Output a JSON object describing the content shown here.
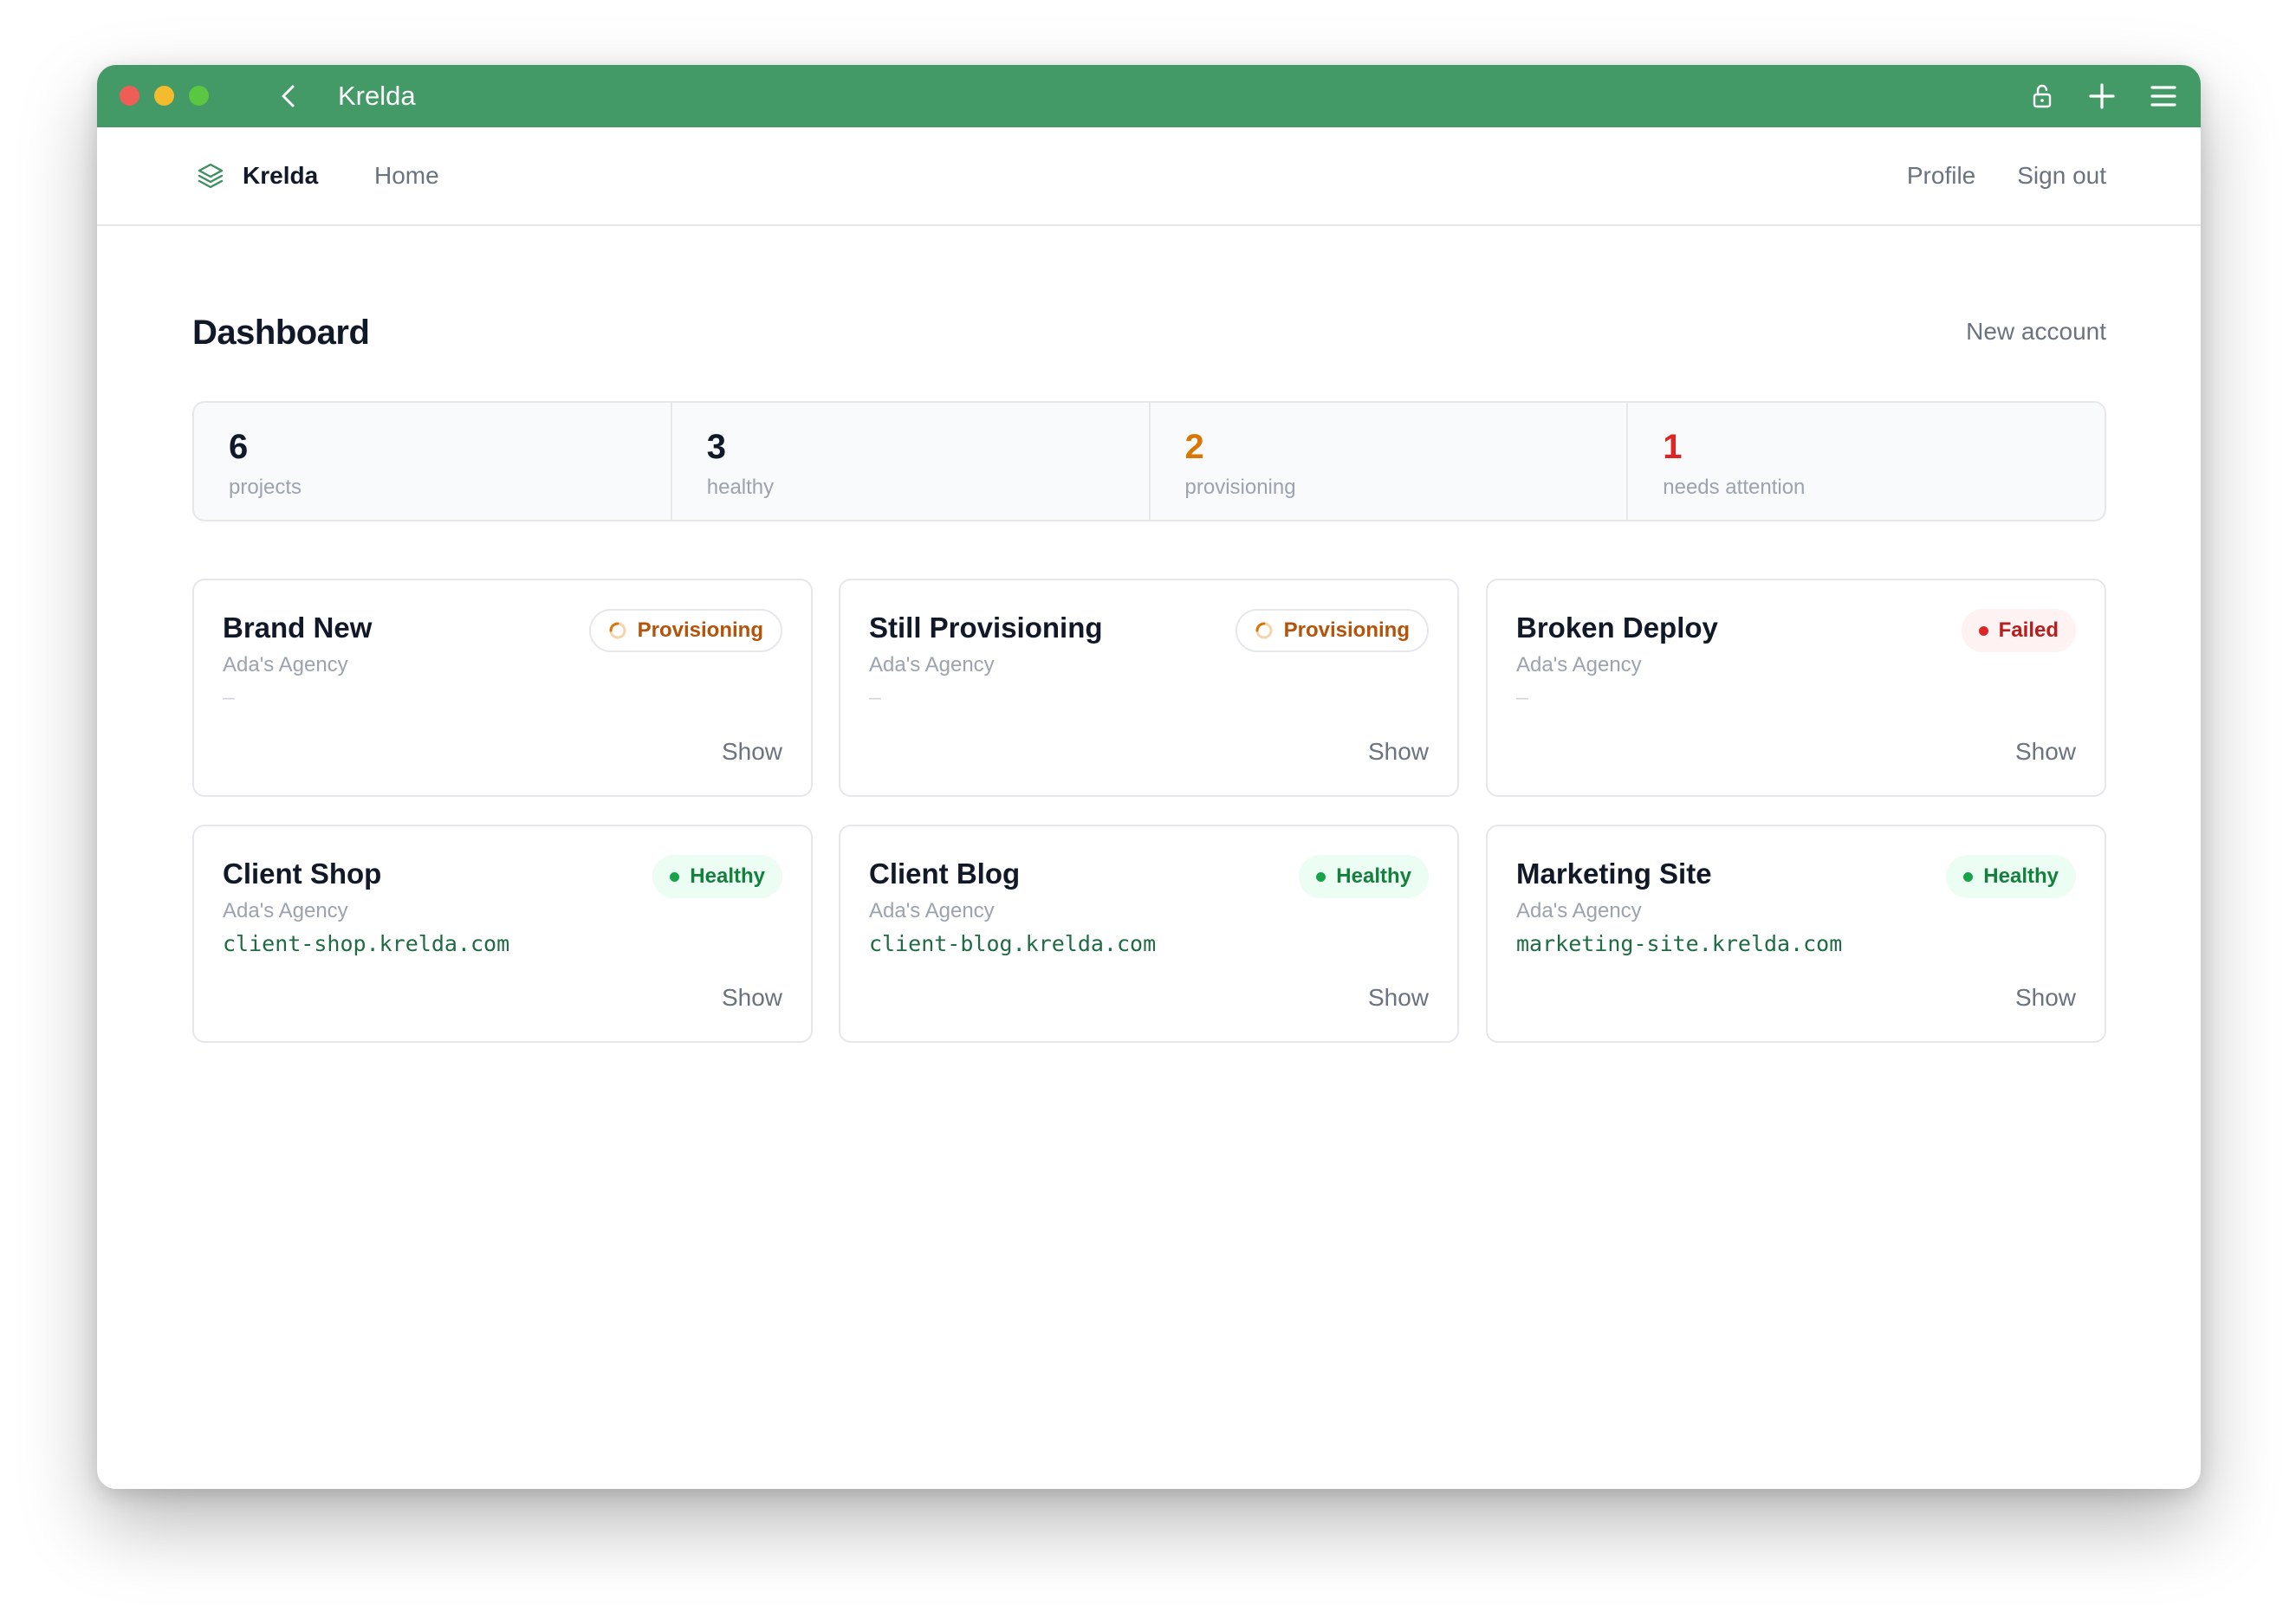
{
  "window": {
    "title": "Krelda"
  },
  "navbar": {
    "brand": "Krelda",
    "home": "Home",
    "profile": "Profile",
    "sign_out": "Sign out"
  },
  "page": {
    "title": "Dashboard",
    "new_account": "New account"
  },
  "stats": [
    {
      "value": "6",
      "label": "projects",
      "color": "#111827"
    },
    {
      "value": "3",
      "label": "healthy",
      "color": "#111827"
    },
    {
      "value": "2",
      "label": "provisioning",
      "color": "#d97706"
    },
    {
      "value": "1",
      "label": "needs attention",
      "color": "#dc2626"
    }
  ],
  "projects": [
    {
      "name": "Brand New",
      "agency": "Ada's Agency",
      "host": "–",
      "status": "Provisioning",
      "show": "Show"
    },
    {
      "name": "Still Provisioning",
      "agency": "Ada's Agency",
      "host": "–",
      "status": "Provisioning",
      "show": "Show"
    },
    {
      "name": "Broken Deploy",
      "agency": "Ada's Agency",
      "host": "–",
      "status": "Failed",
      "show": "Show"
    },
    {
      "name": "Client Shop",
      "agency": "Ada's Agency",
      "host": "client-shop.krelda.com",
      "status": "Healthy",
      "show": "Show"
    },
    {
      "name": "Client Blog",
      "agency": "Ada's Agency",
      "host": "client-blog.krelda.com",
      "status": "Healthy",
      "show": "Show"
    },
    {
      "name": "Marketing Site",
      "agency": "Ada's Agency",
      "host": "marketing-site.krelda.com",
      "status": "Healthy",
      "show": "Show"
    }
  ],
  "colors": {
    "titlebar": "#439a67",
    "provisioning": "#b45309",
    "failed": "#b91c1c",
    "healthy": "#15803d"
  },
  "icons": {
    "titlebar": [
      "back-icon",
      "lock-icon",
      "plus-icon",
      "menu-icon"
    ],
    "brand": "layers-icon"
  }
}
